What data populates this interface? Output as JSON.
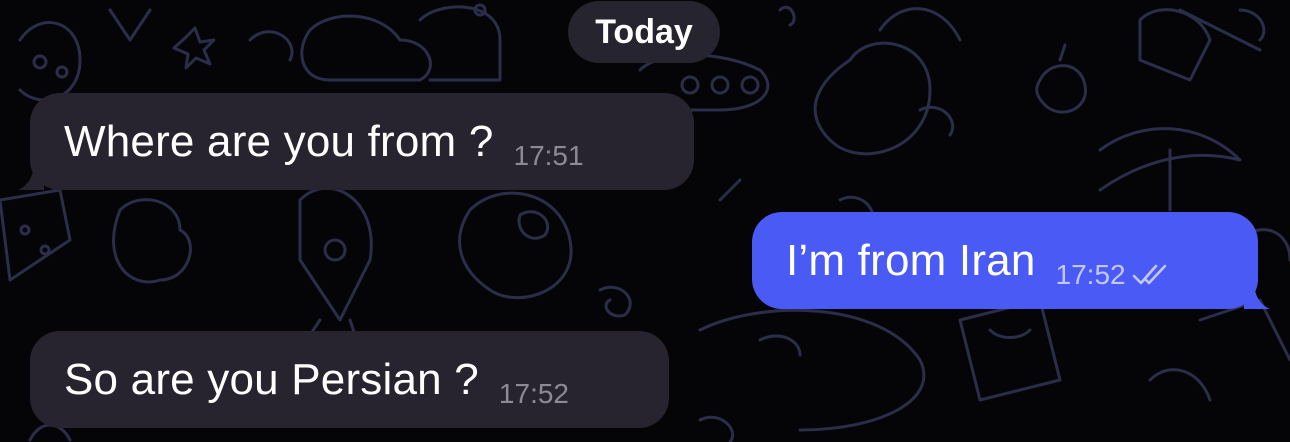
{
  "chat": {
    "date_label": "Today",
    "messages": [
      {
        "direction": "incoming",
        "text": "Where are you from ?",
        "time": "17:51"
      },
      {
        "direction": "outgoing",
        "text": "I’m from Iran",
        "time": "17:52",
        "status_icon": "double-check-icon"
      },
      {
        "direction": "incoming",
        "text": "So are you Persian ?",
        "time": "17:52"
      }
    ]
  },
  "theme": {
    "background": "#050507",
    "incoming_bubble": "#27242f",
    "outgoing_bubble": "#4a5af4",
    "doodle_stroke": "#2b2d4a"
  }
}
